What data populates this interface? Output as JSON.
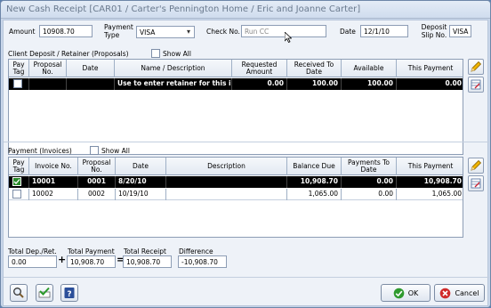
{
  "window": {
    "title": "New Cash Receipt [CAR01 / Carter's Pennington Home / Eric and Joanne Carter]"
  },
  "header": {
    "amount_label": "Amount",
    "amount_value": "10908.70",
    "payment_type_label": "Payment Type",
    "payment_type_value": "VISA",
    "check_no_label": "Check No.",
    "check_no_placeholder": "Run CC",
    "date_label": "Date",
    "date_value": "12/1/10",
    "deposit_slip_label": "Deposit Slip No.",
    "deposit_slip_value": "VISA"
  },
  "proposals": {
    "section_label": "Client Deposit / Retainer (Proposals)",
    "show_all_label": "Show All",
    "columns": [
      "Pay Tag",
      "Proposal No.",
      "Date",
      "Name / Description",
      "Requested Amount",
      "Received To Date",
      "Available",
      "This Payment"
    ],
    "rows": [
      {
        "pay_tag": false,
        "proposal_no": "",
        "date": "",
        "name": "Use to enter retainer for this invoice",
        "requested": "0.00",
        "received": "100.00",
        "available": "100.00",
        "this_payment": "0.00"
      }
    ]
  },
  "invoices": {
    "section_label": "Payment (Invoices)",
    "show_all_label": "Show All",
    "columns": [
      "Pay Tag",
      "Invoice No.",
      "Proposal No.",
      "Date",
      "Description",
      "Balance Due",
      "Payments To Date",
      "This Payment"
    ],
    "rows": [
      {
        "pay_tag": true,
        "invoice_no": "10001",
        "proposal_no": "0001",
        "date": "8/20/10",
        "description": "",
        "balance_due": "10,908.70",
        "payments_to_date": "0.00",
        "this_payment": "10,908.70"
      },
      {
        "pay_tag": false,
        "invoice_no": "10002",
        "proposal_no": "0002",
        "date": "10/19/10",
        "description": "",
        "balance_due": "1,065.00",
        "payments_to_date": "0.00",
        "this_payment": "1,065.00"
      }
    ]
  },
  "totals": {
    "total_dep_label": "Total Dep./Ret.",
    "total_dep_value": "0.00",
    "plus": "+",
    "total_payment_label": "Total Payment",
    "total_payment_value": "10,908.70",
    "equals": "=",
    "total_receipt_label": "Total Receipt",
    "total_receipt_value": "10,908.70",
    "difference_label": "Difference",
    "difference_value": "-10,908.70"
  },
  "footer": {
    "ok_label": "OK",
    "cancel_label": "Cancel"
  },
  "icons": {
    "search": "magnifier-icon",
    "check": "green-check-icon",
    "help": "help-icon",
    "edit": "pencil-icon",
    "table_edit": "table-edit-icon",
    "ok": "ok-check-icon",
    "cancel": "cancel-x-icon"
  }
}
